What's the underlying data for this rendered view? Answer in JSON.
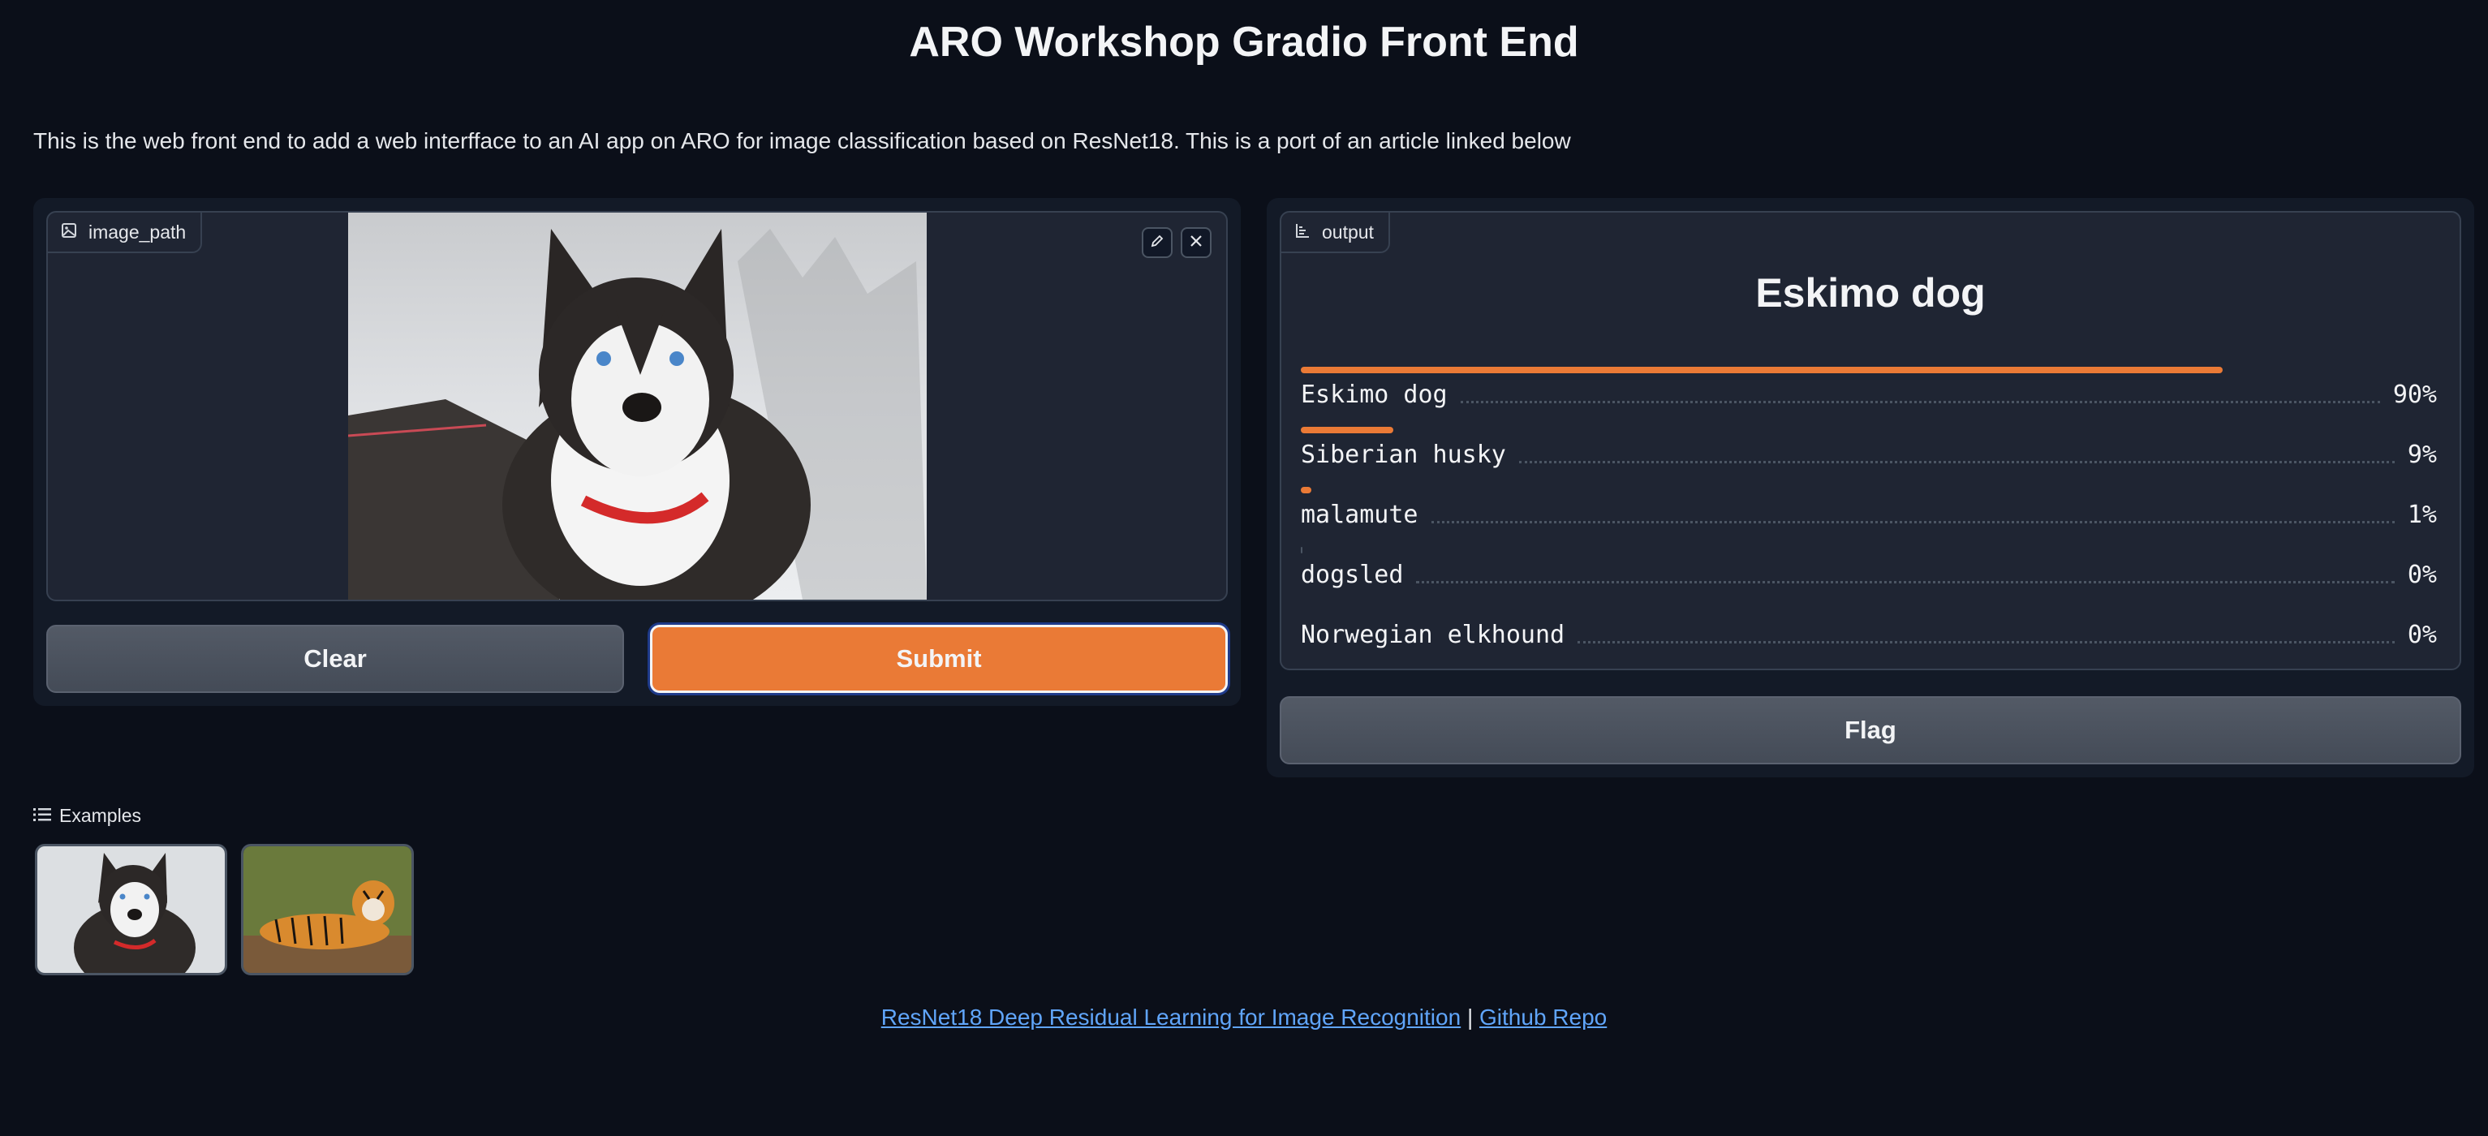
{
  "header": {
    "title": "ARO Workshop Gradio Front End",
    "description": "This is the web front end to add a web interfface to an AI app on ARO for image classification based on ResNet18. This is a port of an article linked below"
  },
  "input": {
    "label": "image_path",
    "label_icon": "image-icon",
    "edit_icon": "pencil-icon",
    "clear_icon": "close-icon"
  },
  "buttons": {
    "clear": "Clear",
    "submit": "Submit",
    "flag": "Flag"
  },
  "output": {
    "label": "output",
    "label_icon": "bar-chart-icon",
    "top_label": "Eskimo dog",
    "confidences": [
      {
        "label": "Eskimo dog",
        "percent": "90%",
        "value": 0.9
      },
      {
        "label": "Siberian husky",
        "percent": "9%",
        "value": 0.09
      },
      {
        "label": "malamute",
        "percent": "1%",
        "value": 0.01
      },
      {
        "label": "dogsled",
        "percent": "0%",
        "value": 0.002
      },
      {
        "label": "Norwegian elkhound",
        "percent": "0%",
        "value": 0.0
      }
    ]
  },
  "examples": {
    "label": "Examples",
    "label_icon": "list-icon",
    "items": [
      "husky-example",
      "tiger-example"
    ]
  },
  "footer": {
    "link1": "ResNet18 Deep Residual Learning for Image Recognition",
    "separator": "|",
    "link2": "Github Repo"
  },
  "colors": {
    "accent": "#ea7a36",
    "background": "#0b0f19",
    "link": "#60a5fa"
  }
}
